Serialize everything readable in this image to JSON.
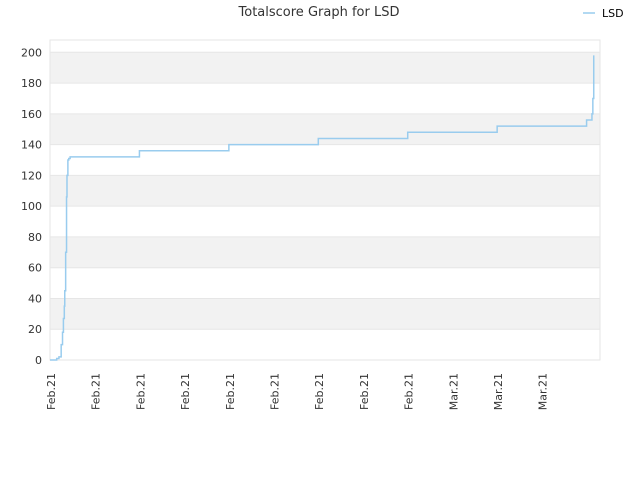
{
  "chart_data": {
    "type": "line",
    "title": "Totalscore Graph for LSD",
    "xlabel": "",
    "ylabel": "",
    "ylim": [
      0,
      208
    ],
    "yticks": [
      0,
      20,
      40,
      60,
      80,
      100,
      120,
      140,
      160,
      180,
      200
    ],
    "xlim": [
      0,
      12.3
    ],
    "xtick_labels": [
      "Feb.21",
      "Feb.21",
      "Feb.21",
      "Feb.21",
      "Feb.21",
      "Feb.21",
      "Feb.21",
      "Feb.21",
      "Feb.21",
      "Mar.21",
      "Mar.21",
      "Mar.21"
    ],
    "grid": true,
    "legend_position": "top-right",
    "line_color": "#99ccee",
    "band_color": "#f2f2f2",
    "series": [
      {
        "name": "LSD",
        "step": true,
        "x": [
          0,
          0.15,
          0.2,
          0.25,
          0.28,
          0.3,
          0.32,
          0.33,
          0.35,
          0.37,
          0.38,
          0.4,
          0.42,
          0.45,
          2,
          4,
          6,
          8,
          10,
          12,
          12.12,
          12.14,
          12.16
        ],
        "y": [
          0,
          1,
          2,
          10,
          18,
          27,
          35,
          45,
          70,
          106,
          120,
          130,
          131,
          132,
          136,
          140,
          144,
          148,
          152,
          156,
          160,
          170,
          198
        ]
      }
    ]
  }
}
